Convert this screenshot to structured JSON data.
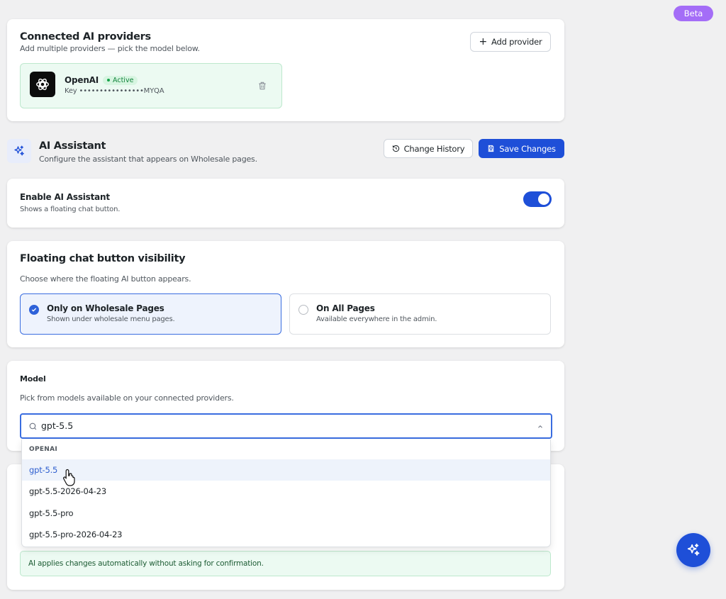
{
  "beta_label": "Beta",
  "providers": {
    "title": "Connected AI providers",
    "subtitle": "Add multiple providers — pick the model below.",
    "add_label": "Add provider",
    "items": [
      {
        "name": "OpenAI",
        "status": "Active",
        "key": "Key ••••••••••••••••MYQA"
      }
    ]
  },
  "assistant": {
    "title": "AI Assistant",
    "subtitle": "Configure the assistant that appears on Wholesale pages.",
    "history_label": "Change History",
    "save_label": "Save Changes"
  },
  "enable": {
    "title": "Enable AI Assistant",
    "subtitle": "Shows a floating chat button.",
    "enabled": true
  },
  "visibility": {
    "title": "Floating chat button visibility",
    "subtitle": "Choose where the floating AI button appears.",
    "options": [
      {
        "title": "Only on Wholesale Pages",
        "desc": "Shown under wholesale menu pages.",
        "selected": true
      },
      {
        "title": "On All Pages",
        "desc": "Available everywhere in the admin.",
        "selected": false
      }
    ]
  },
  "model": {
    "title": "Model",
    "subtitle": "Pick from models available on your connected providers.",
    "search_value": "gpt-5.5",
    "group_label": "OPENAI",
    "options": [
      "gpt-5.5",
      "gpt-5.5-2026-04-23",
      "gpt-5.5-pro",
      "gpt-5.5-pro-2026-04-23"
    ],
    "highlighted": "gpt-5.5"
  },
  "auto_notice": "AI applies changes automatically without asking for confirmation.",
  "colors": {
    "primary": "#1e4fd8",
    "beta": "#a46df7",
    "success": "#17a34a",
    "background": "#f0f0f1"
  }
}
